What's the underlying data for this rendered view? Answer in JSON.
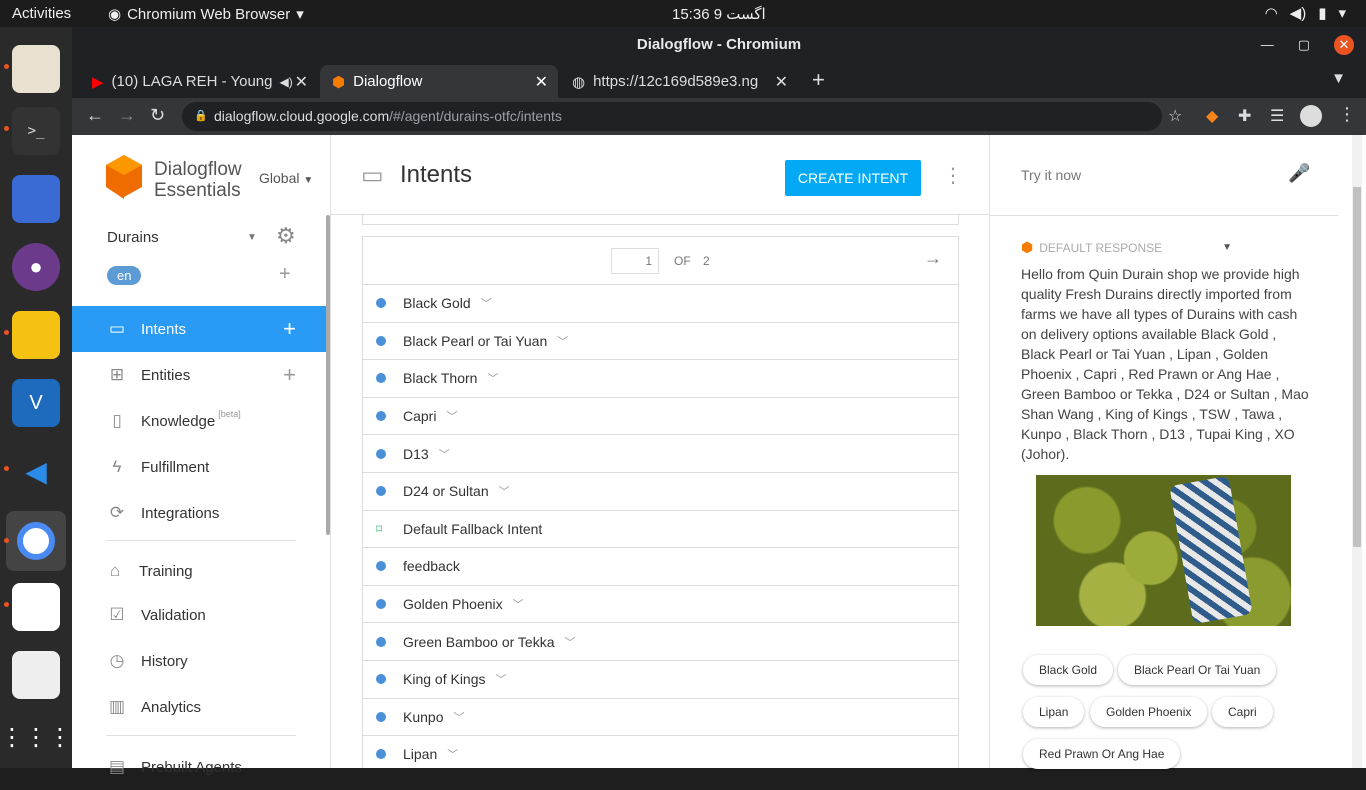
{
  "os": {
    "activities": "Activities",
    "app_menu": "Chromium Web Browser",
    "clock": "15:36  اگست 9"
  },
  "window": {
    "title": "Dialogflow - Chromium"
  },
  "tabs": [
    {
      "label": "(10) LAGA REH - Young",
      "active": false
    },
    {
      "label": "Dialogflow",
      "active": true
    },
    {
      "label": "https://12c169d589e3.ng",
      "active": false
    }
  ],
  "address": {
    "host": "dialogflow.cloud.google.com",
    "path": "/#/agent/durains-otfc/intents"
  },
  "sidebar": {
    "brand_line1": "Dialogflow",
    "brand_line2": "Essentials",
    "region": "Global",
    "agent": "Durains",
    "lang": "en",
    "items": [
      {
        "label": "Intents",
        "icon": "chat-icon"
      },
      {
        "label": "Entities",
        "icon": "hierarchy-icon"
      },
      {
        "label": "Knowledge",
        "icon": "book-icon",
        "badge": "[beta]"
      },
      {
        "label": "Fulfillment",
        "icon": "bolt-icon"
      },
      {
        "label": "Integrations",
        "icon": "sync-icon"
      },
      {
        "label": "Training",
        "icon": "graduation-icon"
      },
      {
        "label": "Validation",
        "icon": "check-icon"
      },
      {
        "label": "History",
        "icon": "clock-icon"
      },
      {
        "label": "Analytics",
        "icon": "chart-icon"
      },
      {
        "label": "Prebuilt Agents",
        "icon": "agent-icon"
      }
    ]
  },
  "main": {
    "title": "Intents",
    "create_button": "CREATE INTENT",
    "pager": {
      "current": "1",
      "of": "OF",
      "total": "2"
    },
    "intents": [
      "Black Gold",
      "Black Pearl or Tai Yuan",
      "Black Thorn",
      "Capri",
      "D13",
      "D24 or Sultan",
      "Default Fallback Intent",
      "feedback",
      "Golden Phoenix",
      "Green Bamboo or Tekka",
      "King of Kings",
      "Kunpo",
      "Lipan"
    ]
  },
  "right": {
    "try_placeholder": "Try it now",
    "default_response": "DEFAULT RESPONSE",
    "response_text": "Hello from Quin Durain shop we provide high quality Fresh Durains directly imported from farms we have all types of Durains with cash on delivery options available Black Gold , Black Pearl or Tai Yuan , Lipan , Golden Phoenix , Capri , Red Prawn or Ang Hae , Green Bamboo or Tekka , D24 or Sultan , Mao Shan Wang , King of Kings , TSW , Tawa , Kunpo , Black Thorn , D13 , Tupai King , XO (Johor).",
    "chips": [
      "Black Gold",
      "Black Pearl Or Tai Yuan",
      "Lipan",
      "Golden Phoenix",
      "Capri",
      "Red Prawn Or Ang Hae"
    ]
  }
}
